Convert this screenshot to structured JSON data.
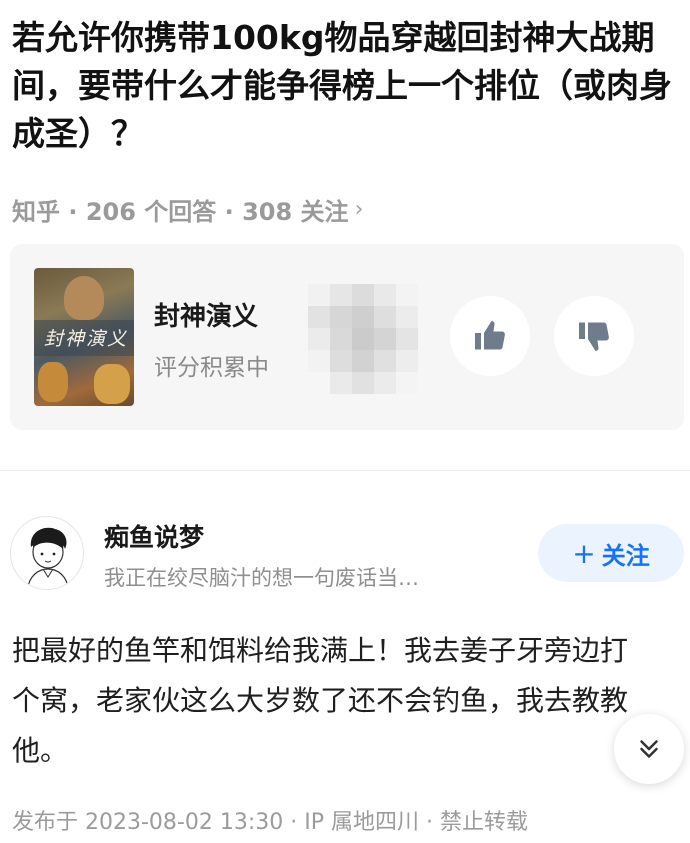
{
  "question": {
    "title": "若允许你携带100kg物品穿越回封神大战期间，要带什么才能争得榜上一个排位（或肉身成圣）？",
    "meta": "知乎 · 206 个回答 · 308 关注",
    "chevron_icon": "chevron-right-icon"
  },
  "media_card": {
    "poster_text": "封神演义",
    "name": "封神演义",
    "rating_status": "评分积累中",
    "thumbs_up_icon": "thumbs-up-icon",
    "thumbs_down_icon": "thumbs-down-icon"
  },
  "author": {
    "name": "痴鱼说梦",
    "bio": "我正在绞尽脑汁的想一句废话当…",
    "follow_label": "关注",
    "follow_plus": "+"
  },
  "answer": {
    "text": "把最好的鱼竿和饵料给我满上！我去姜子牙旁边打个窝，老家伙这么大岁数了还不会钓鱼，我去教教他。",
    "expand_icon": "double-chevron-down-icon"
  },
  "footer": {
    "text": "发布于 2023-08-02 13:30 · IP 属地四川 · 禁止转载"
  },
  "colors": {
    "accent": "#1772f6",
    "follow_bg": "#ebf3ff",
    "card_bg": "#f6f6f6",
    "muted_text": "#9a9a9a",
    "icon_gray": "#6f7c8c"
  }
}
